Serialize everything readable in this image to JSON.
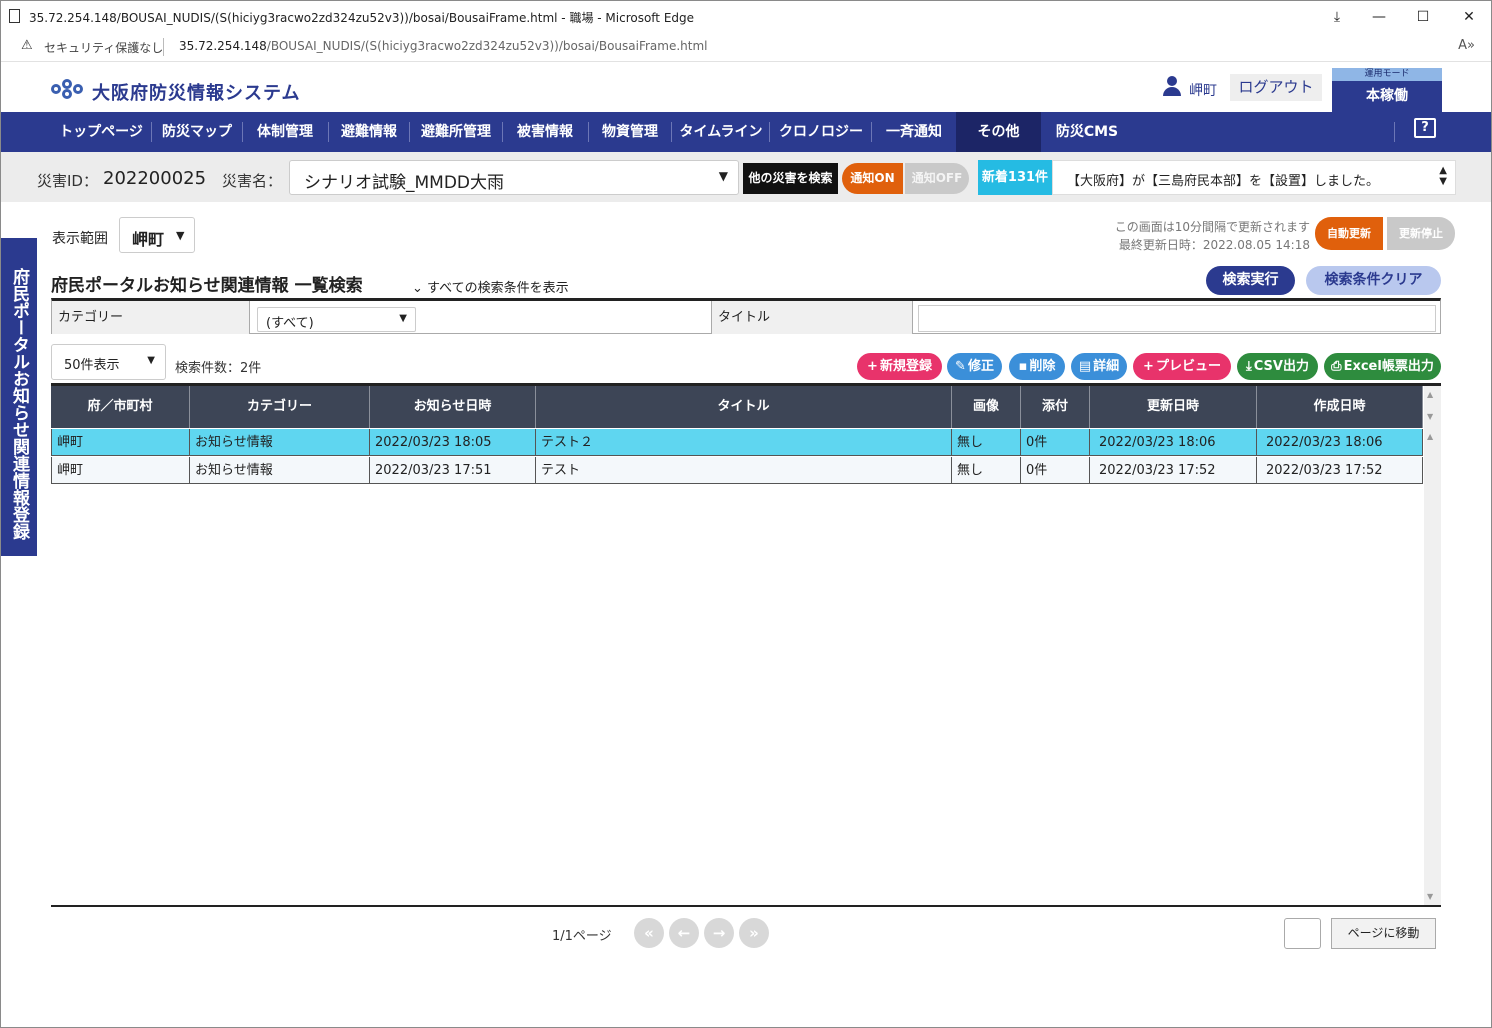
{
  "window": {
    "title": "35.72.254.148/BOUSAI_NUDIS/(S(hiciyg3racwo2zd324zu52v3))/bosai/BousaiFrame.html - 職場 - Microsoft Edge",
    "minimize": "—",
    "maximize": "☐",
    "close": "✕",
    "download": "⤓"
  },
  "address": {
    "security": "セキュリティ保護なし",
    "host": "35.72.254.148",
    "path": "/BOUSAI_NUDIS/(S(hiciyg3racwo2zd324zu52v3))/bosai/BousaiFrame.html",
    "read_aloud": "A»"
  },
  "header": {
    "system_title": "大阪府防災情報システム",
    "user": "岬町",
    "logout": "ログアウト",
    "mode_label": "運用モード",
    "mode_value": "本稼働"
  },
  "nav": {
    "items": [
      "トップページ",
      "防災マップ",
      "体制管理",
      "避難情報",
      "避難所管理",
      "被害情報",
      "物資管理",
      "タイムライン",
      "クロノロジー",
      "一斉通知",
      "その他",
      "防災CMS"
    ],
    "active": "その他",
    "help": "?"
  },
  "disaster": {
    "id_label": "災害ID：",
    "id_value": "202200025",
    "name_label": "災害名：",
    "name_value": "シナリオ試験_MMDD大雨",
    "search_other": "他の災害を検索",
    "notify_on": "通知ON",
    "notify_off": "通知OFF",
    "news_badge": "新着131件",
    "news_text": "【大阪府】が【三島府民本部】を【設置】しました。"
  },
  "sidetab": "府民ポータルお知らせ関連情報登録",
  "content": {
    "range_label": "表示範囲",
    "range_value": "岬町",
    "refresh_note": "この画面は10分間隔で更新されます",
    "last_update": "最終更新日時：2022.08.05 14:18",
    "auto_refresh": "自動更新",
    "stop_refresh": "更新停止",
    "search_title": "府民ポータルお知らせ関連情報 一覧検索",
    "show_conditions": "すべての検索条件を表示",
    "search_button": "検索実行",
    "clear_button": "検索条件クリア",
    "category_label": "カテゴリー",
    "category_value": "(すべて)",
    "title_label": "タイトル",
    "title_value": "",
    "page_size": "50件表示",
    "result_count": "検索件数：2件",
    "actions": {
      "new": "新規登録",
      "edit": "修正",
      "delete": "削除",
      "detail": "詳細",
      "preview": "プレビュー",
      "csv": "CSV出力",
      "excel": "Excel帳票出力"
    },
    "colors": {
      "new": "#e8336b",
      "edit": "#3b8fd9",
      "delete": "#3b8fd9",
      "detail": "#3b8fd9",
      "preview": "#e8336b",
      "csv": "#2e8c3e",
      "excel": "#2e8c3e",
      "selected_row": "#5fd6f0"
    }
  },
  "grid": {
    "columns": [
      "府／市町村",
      "カテゴリー",
      "お知らせ日時",
      "タイトル",
      "画像",
      "添付",
      "更新日時",
      "作成日時"
    ],
    "rows": [
      [
        "岬町",
        "お知らせ情報",
        "2022/03/23 18:05",
        "テスト２",
        "無し",
        "0件",
        "2022/03/23 18:06",
        "2022/03/23 18:06"
      ],
      [
        "岬町",
        "お知らせ情報",
        "2022/03/23 17:51",
        "テスト",
        "無し",
        "0件",
        "2022/03/23 17:52",
        "2022/03/23 17:52"
      ]
    ],
    "selected_row": 0
  },
  "paging": {
    "info": "1/1ページ",
    "first": "«",
    "prev": "←",
    "next": "→",
    "last": "»",
    "goto": "ページに移動"
  }
}
